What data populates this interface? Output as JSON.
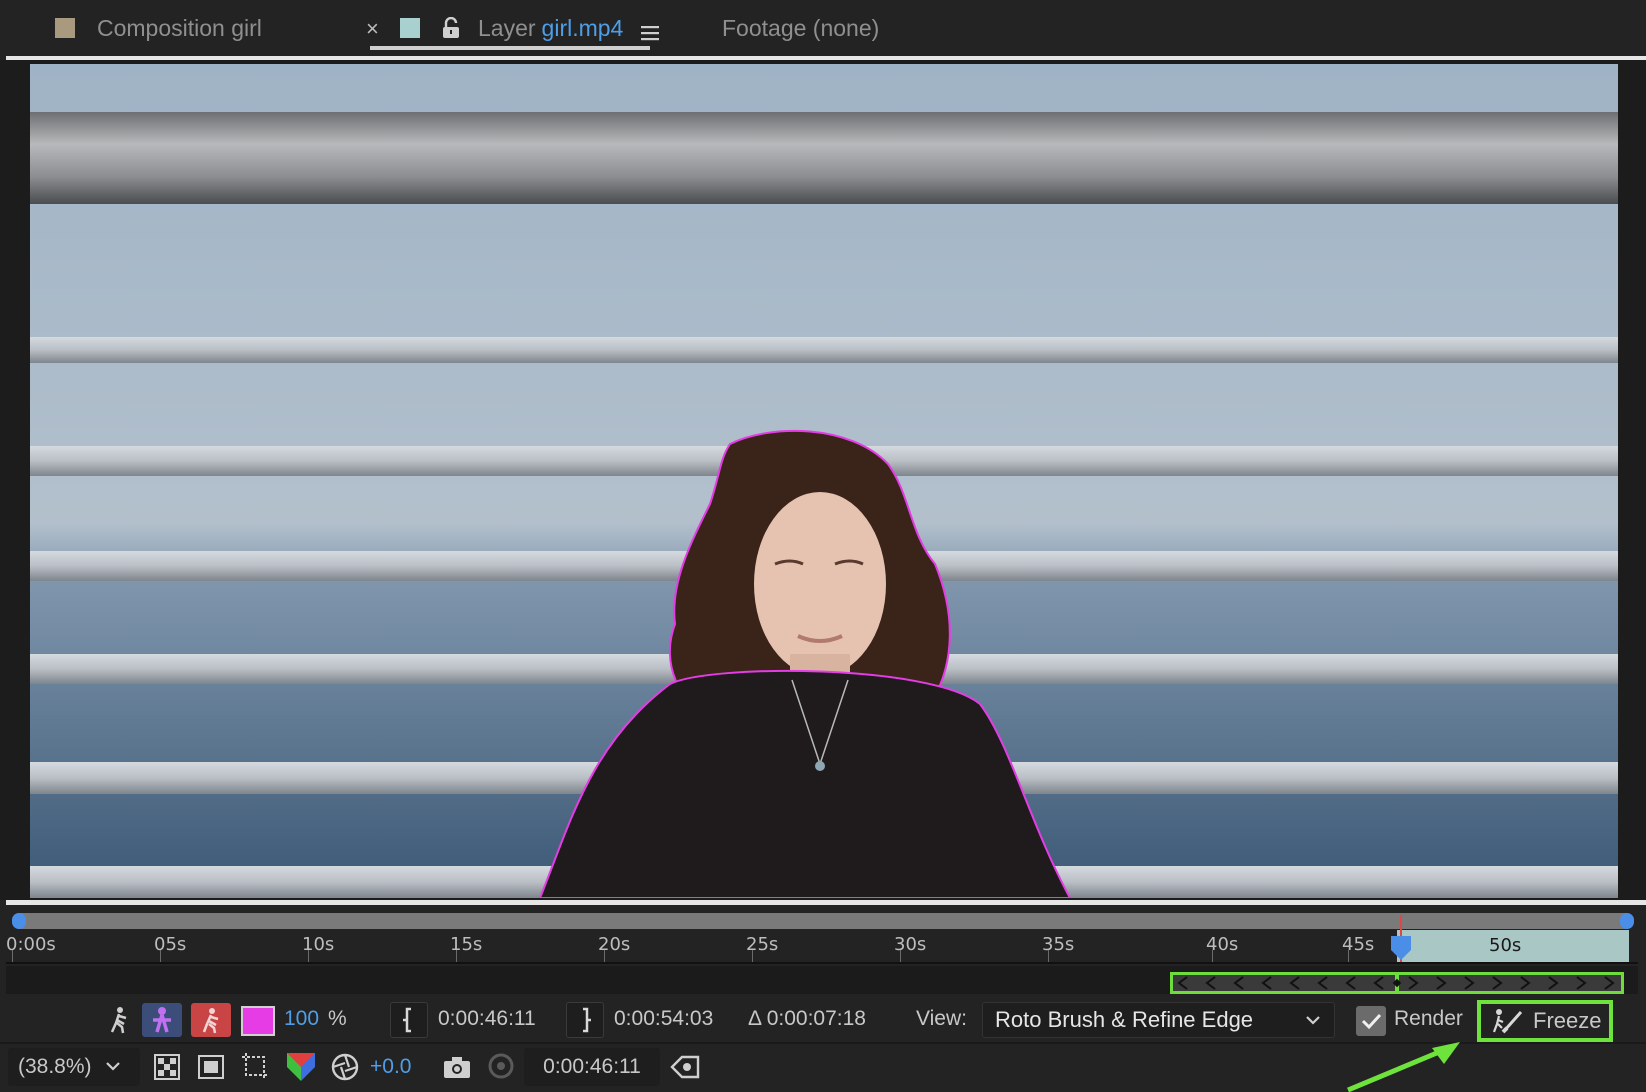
{
  "tabs": {
    "composition": {
      "label": "Composition girl"
    },
    "layer": {
      "prefix": "Layer",
      "name": "girl.mp4"
    },
    "footage": {
      "label": "Footage (none)"
    },
    "close_glyph": "×"
  },
  "timeline": {
    "ruler_labels": [
      "0:00s",
      "05s",
      "10s",
      "15s",
      "20s",
      "25s",
      "30s",
      "35s",
      "40s",
      "45s",
      "50s"
    ],
    "current_label": "50s"
  },
  "toolbar": {
    "mask_opacity": "100",
    "percent_sign": "%",
    "in_point": "0:00:46:11",
    "out_point": "0:00:54:03",
    "duration": "Δ 0:00:07:18",
    "view_label": "View:",
    "view_value": "Roto Brush & Refine Edge",
    "render_label": "Render",
    "render_checked": true,
    "freeze_label": "Freeze",
    "mask_color": "#e53ce6"
  },
  "status": {
    "zoom": "(38.8%)",
    "exposure": "+0.0",
    "timecode": "0:00:46:11"
  },
  "colors": {
    "accent_blue": "#4e9ee8",
    "highlight_green": "#6ee33c",
    "roto_outline": "#e53ce6"
  }
}
